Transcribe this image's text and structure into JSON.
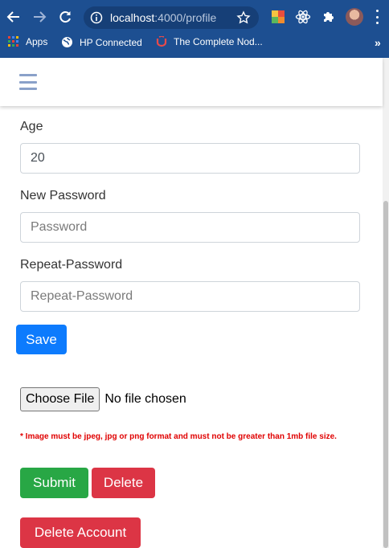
{
  "browser": {
    "url_host": "localhost",
    "url_path": ":4000/profile",
    "bookmarks": [
      {
        "label": "Apps"
      },
      {
        "label": "HP Connected"
      },
      {
        "label": "The Complete Nod..."
      }
    ],
    "more_bookmarks": "»"
  },
  "form": {
    "age_label": "Age",
    "age_value": "20",
    "new_password_label": "New Password",
    "new_password_placeholder": "Password",
    "repeat_password_label": "Repeat-Password",
    "repeat_password_placeholder": "Repeat-Password",
    "save_label": "Save"
  },
  "upload": {
    "choose_file_label": "Choose File",
    "file_status": "No file chosen",
    "note": "* Image must be jpeg, jpg or png format and must not be greater than 1mb file size.",
    "submit_label": "Submit",
    "delete_label": "Delete"
  },
  "account": {
    "delete_account_label": "Delete Account"
  },
  "colors": {
    "chrome_bg": "#1d4f91",
    "primary": "#0d7bfd",
    "success": "#28a745",
    "danger": "#dc3545",
    "note_red": "#e00000"
  }
}
